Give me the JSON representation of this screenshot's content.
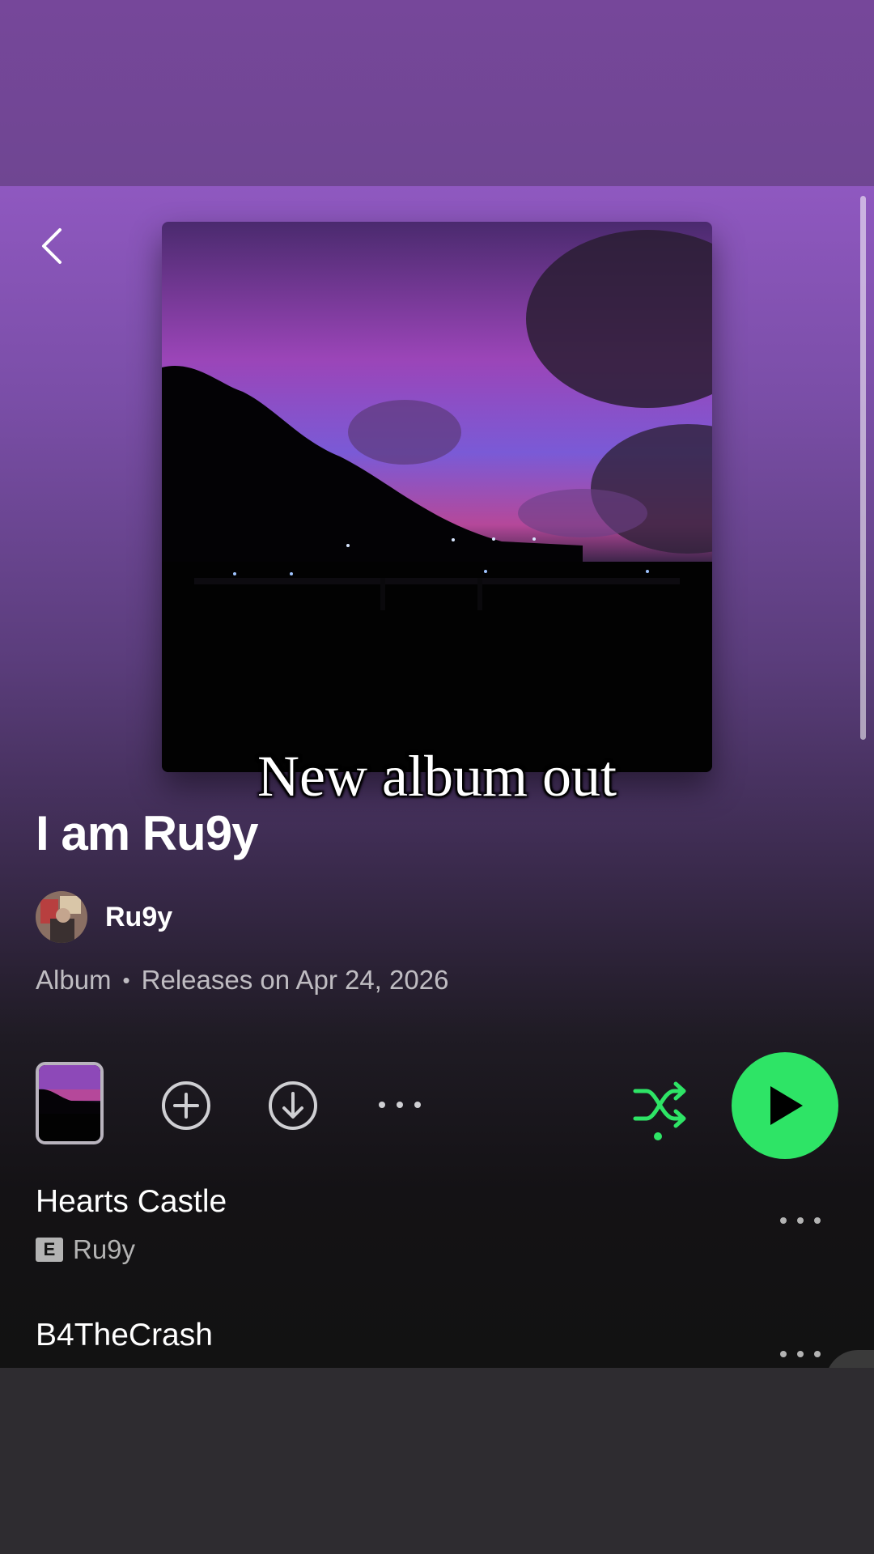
{
  "overlay": {
    "caption": "New album out"
  },
  "album": {
    "title": "I am Ru9y",
    "artist": "Ru9y",
    "type": "Album",
    "release": "Releases on Apr 24, 2026"
  },
  "tracks": [
    {
      "title": "Hearts Castle",
      "explicit": "E",
      "artist": "Ru9y"
    },
    {
      "title": "B4TheCrash"
    }
  ],
  "colors": {
    "accent": "#2ee466",
    "background": "#121212"
  },
  "icons": [
    "back-icon",
    "add-icon",
    "download-icon",
    "more-icon",
    "shuffle-icon",
    "play-icon"
  ]
}
